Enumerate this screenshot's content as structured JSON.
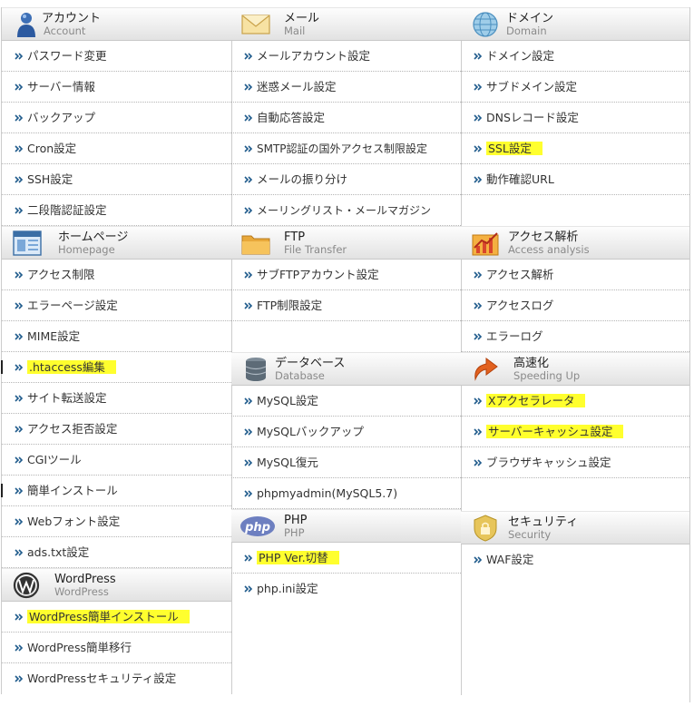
{
  "columns": [
    {
      "sections": [
        {
          "title": "アカウント",
          "subtitle": "Account",
          "icon": "account-user-icon",
          "items": [
            {
              "label": "パスワード変更"
            },
            {
              "label": "サーバー情報"
            },
            {
              "label": "バックアップ"
            },
            {
              "label": "Cron設定"
            },
            {
              "label": "SSH設定"
            },
            {
              "label": "二段階認証設定"
            }
          ]
        },
        {
          "title": "ホームページ",
          "subtitle": "Homepage",
          "icon": "homepage-window-icon",
          "items": [
            {
              "label": "アクセス制限"
            },
            {
              "label": "エラーページ設定"
            },
            {
              "label": "MIME設定"
            },
            {
              "label": ".htaccess編集",
              "highlight": true
            },
            {
              "label": "サイト転送設定"
            },
            {
              "label": "アクセス拒否設定"
            },
            {
              "label": "CGIツール"
            },
            {
              "label": "簡単インストール"
            },
            {
              "label": "Webフォント設定"
            },
            {
              "label": "ads.txt設定"
            }
          ]
        },
        {
          "title": "WordPress",
          "subtitle": "WordPress",
          "icon": "wordpress-logo-icon",
          "items": [
            {
              "label": "WordPress簡単インストール",
              "highlight": true
            },
            {
              "label": "WordPress簡単移行"
            },
            {
              "label": "WordPressセキュリティ設定"
            }
          ]
        }
      ]
    },
    {
      "sections": [
        {
          "title": "メール",
          "subtitle": "Mail",
          "icon": "mail-envelope-icon",
          "items": [
            {
              "label": "メールアカウント設定"
            },
            {
              "label": "迷惑メール設定"
            },
            {
              "label": "自動応答設定"
            },
            {
              "label": "SMTP認証の国外アクセス制限設定"
            },
            {
              "label": "メールの振り分け"
            },
            {
              "label": "メーリングリスト・メールマガジン"
            }
          ]
        },
        {
          "title": "FTP",
          "subtitle": "File Transfer",
          "icon": "ftp-folder-icon",
          "items": [
            {
              "label": "サブFTPアカウント設定"
            },
            {
              "label": "FTP制限設定"
            }
          ]
        },
        {
          "title": "データベース",
          "subtitle": "Database",
          "icon": "database-cylinder-icon",
          "items": [
            {
              "label": "MySQL設定"
            },
            {
              "label": "MySQLバックアップ"
            },
            {
              "label": "MySQL復元"
            },
            {
              "label": "phpmyadmin(MySQL5.7)"
            }
          ]
        },
        {
          "title": "PHP",
          "subtitle": "PHP",
          "icon": "php-logo-icon",
          "items": [
            {
              "label": "PHP Ver.切替",
              "highlight": true
            },
            {
              "label": "php.ini設定"
            }
          ]
        }
      ]
    },
    {
      "sections": [
        {
          "title": "ドメイン",
          "subtitle": "Domain",
          "icon": "domain-globe-icon",
          "items": [
            {
              "label": "ドメイン設定"
            },
            {
              "label": "サブドメイン設定"
            },
            {
              "label": "DNSレコード設定"
            },
            {
              "label": "SSL設定",
              "highlight": true
            },
            {
              "label": "動作確認URL"
            }
          ]
        },
        {
          "title": "アクセス解析",
          "subtitle": "Access analysis",
          "icon": "access-chart-icon",
          "items": [
            {
              "label": "アクセス解析"
            },
            {
              "label": "アクセスログ"
            },
            {
              "label": "エラーログ"
            }
          ]
        },
        {
          "title": "高速化",
          "subtitle": "Speeding Up",
          "icon": "speedup-arrow-icon",
          "items": [
            {
              "label": "Xアクセラレータ",
              "highlight": true
            },
            {
              "label": "サーバーキャッシュ設定",
              "highlight": true
            },
            {
              "label": "ブラウザキャッシュ設定"
            }
          ]
        },
        {
          "title": "セキュリティ",
          "subtitle": "Security",
          "icon": "security-shield-icon",
          "items": [
            {
              "label": "WAF設定"
            }
          ]
        }
      ]
    }
  ]
}
